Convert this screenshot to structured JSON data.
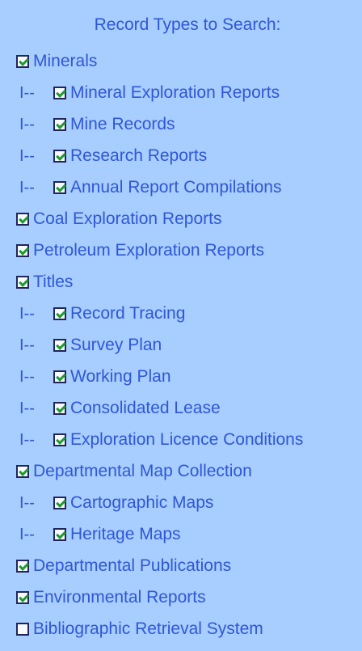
{
  "header": {
    "title": "Record Types to Search:"
  },
  "tree_prefix": "I--",
  "items": [
    {
      "label": "Minerals",
      "checked": true,
      "level": 0,
      "name": "minerals"
    },
    {
      "label": "Mineral Exploration Reports",
      "checked": true,
      "level": 1,
      "name": "mineral-exploration-reports"
    },
    {
      "label": "Mine Records",
      "checked": true,
      "level": 1,
      "name": "mine-records"
    },
    {
      "label": "Research Reports",
      "checked": true,
      "level": 1,
      "name": "research-reports"
    },
    {
      "label": "Annual Report Compilations",
      "checked": true,
      "level": 1,
      "name": "annual-report-compilations"
    },
    {
      "label": "Coal Exploration Reports",
      "checked": true,
      "level": 0,
      "name": "coal-exploration-reports"
    },
    {
      "label": "Petroleum Exploration Reports",
      "checked": true,
      "level": 0,
      "name": "petroleum-exploration-reports"
    },
    {
      "label": "Titles",
      "checked": true,
      "level": 0,
      "name": "titles"
    },
    {
      "label": "Record Tracing",
      "checked": true,
      "level": 1,
      "name": "record-tracing"
    },
    {
      "label": "Survey Plan",
      "checked": true,
      "level": 1,
      "name": "survey-plan"
    },
    {
      "label": "Working Plan",
      "checked": true,
      "level": 1,
      "name": "working-plan"
    },
    {
      "label": "Consolidated Lease",
      "checked": true,
      "level": 1,
      "name": "consolidated-lease"
    },
    {
      "label": "Exploration Licence Conditions",
      "checked": true,
      "level": 1,
      "name": "exploration-licence-conditions"
    },
    {
      "label": "Departmental Map Collection",
      "checked": true,
      "level": 0,
      "name": "departmental-map-collection"
    },
    {
      "label": "Cartographic Maps",
      "checked": true,
      "level": 1,
      "name": "cartographic-maps"
    },
    {
      "label": "Heritage Maps",
      "checked": true,
      "level": 1,
      "name": "heritage-maps"
    },
    {
      "label": "Departmental Publications",
      "checked": true,
      "level": 0,
      "name": "departmental-publications"
    },
    {
      "label": "Environmental Reports",
      "checked": true,
      "level": 0,
      "name": "environmental-reports"
    },
    {
      "label": "Bibliographic Retrieval System",
      "checked": false,
      "level": 0,
      "name": "bibliographic-retrieval-system"
    }
  ],
  "colors": {
    "background": "#a8cdff",
    "text": "#2f57d6",
    "checkbox_border": "#20265a",
    "check_mark": "#1f9b2c"
  }
}
